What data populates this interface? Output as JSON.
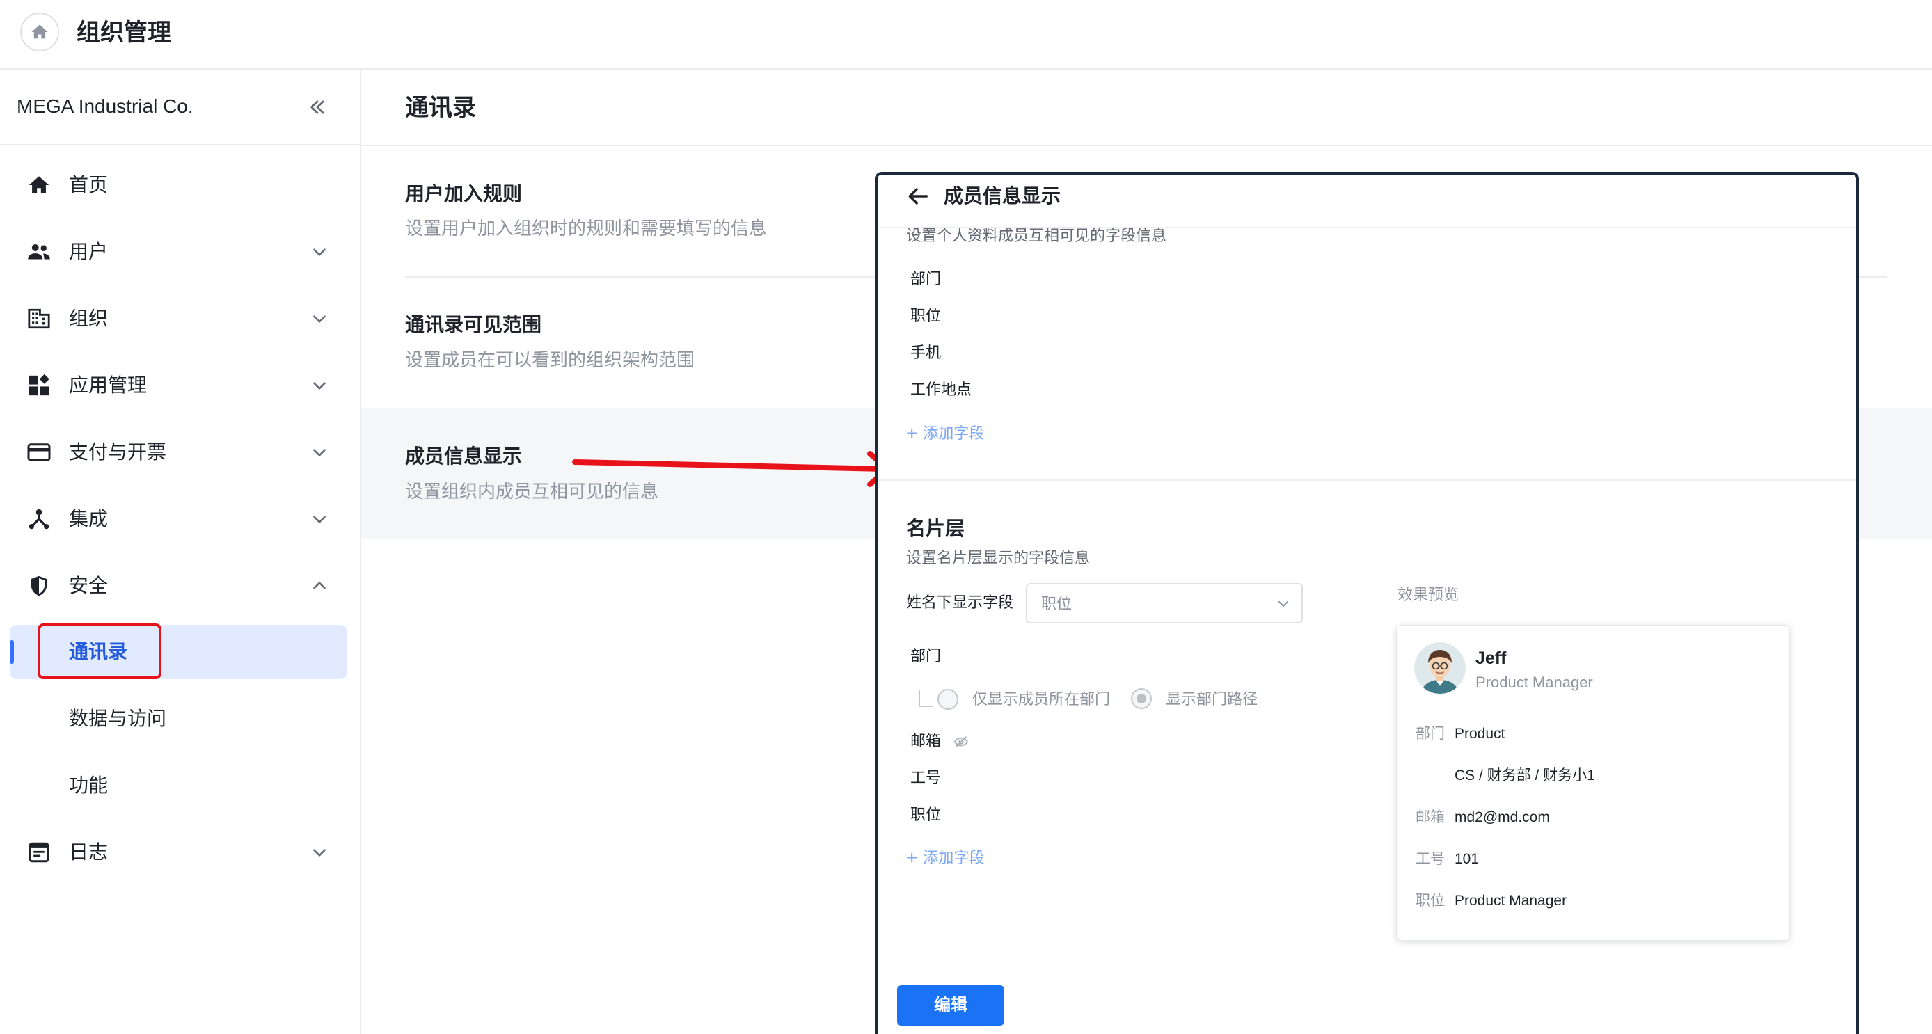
{
  "header": {
    "title": "组织管理",
    "home_icon": "home-icon"
  },
  "sidebar": {
    "org_name": "MEGA Industrial Co.",
    "collapse_icon": "double-chevron-left-icon",
    "items": [
      {
        "label": "首页",
        "icon": "home-icon"
      },
      {
        "label": "用户",
        "icon": "users-icon"
      },
      {
        "label": "组织",
        "icon": "building-icon"
      },
      {
        "label": "应用管理",
        "icon": "apps-icon"
      },
      {
        "label": "支付与开票",
        "icon": "credit-card-icon"
      },
      {
        "label": "集成",
        "icon": "integration-icon"
      },
      {
        "label": "安全",
        "icon": "shield-icon",
        "expanded": true
      },
      {
        "label": "通讯录",
        "sub": true,
        "active": true
      },
      {
        "label": "数据与访问",
        "sub": true
      },
      {
        "label": "功能",
        "sub": true
      },
      {
        "label": "日志",
        "icon": "log-icon"
      }
    ]
  },
  "main": {
    "title": "通讯录",
    "settings": [
      {
        "title": "用户加入规则",
        "desc": "设置用户加入组织时的规则和需要填写的信息"
      },
      {
        "title": "通讯录可见范围",
        "desc": "设置成员在可以看到的组织架构范围"
      },
      {
        "title": "成员信息显示",
        "desc": "设置组织内成员互相可见的信息"
      }
    ]
  },
  "panel": {
    "title": "成员信息显示",
    "profile_desc": "设置个人资料成员互相可见的字段信息",
    "profile_fields": [
      "部门",
      "职位",
      "手机",
      "工作地点"
    ],
    "add_field": "添加字段",
    "card_title": "名片层",
    "card_desc": "设置名片层显示的字段信息",
    "name_field_label": "姓名下显示字段",
    "name_field_value": "职位",
    "dept_label": "部门",
    "radio_own_dept": "仅显示成员所在部门",
    "radio_dept_path": "显示部门路径",
    "card_fields": [
      "邮箱",
      "工号",
      "职位"
    ],
    "edit_button": "编辑"
  },
  "preview": {
    "label": "效果预览",
    "name": "Jeff",
    "title": "Product Manager",
    "rows": [
      {
        "key": "部门",
        "value": "Product"
      },
      {
        "key": "",
        "value": "CS / 财务部 / 财务小1"
      },
      {
        "key": "邮箱",
        "value": "md2@md.com"
      },
      {
        "key": "工号",
        "value": "101"
      },
      {
        "key": "职位",
        "value": "Product Manager"
      }
    ]
  },
  "colors": {
    "accent": "#3370ff",
    "button": "#1a73f5",
    "highlight": "#e8121b",
    "active_bg": "#e1eaff"
  }
}
